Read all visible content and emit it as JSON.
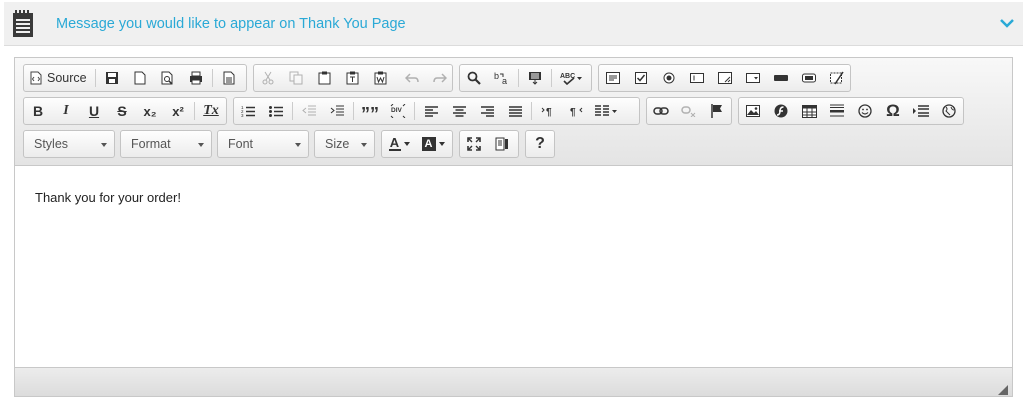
{
  "panel": {
    "title": "Message you would like to appear on Thank You Page",
    "icon": "notepad-icon",
    "toggle_icon": "chevron-down-icon",
    "accent_color": "#2aa9d6"
  },
  "toolbar": {
    "source_label": "Source",
    "formatting": {
      "bold": "B",
      "italic": "I",
      "underline": "U",
      "strike": "S",
      "subscript": "x₂",
      "superscript": "x²",
      "remove_format": "Tx",
      "blockquote": "””",
      "div": "DIV",
      "omega": "Ω",
      "help": "?",
      "text_color_label": "A",
      "bg_color_label": "A"
    },
    "combos": {
      "styles": "Styles",
      "format": "Format",
      "font": "Font",
      "size": "Size"
    }
  },
  "editor": {
    "content": "Thank you for your order!"
  }
}
